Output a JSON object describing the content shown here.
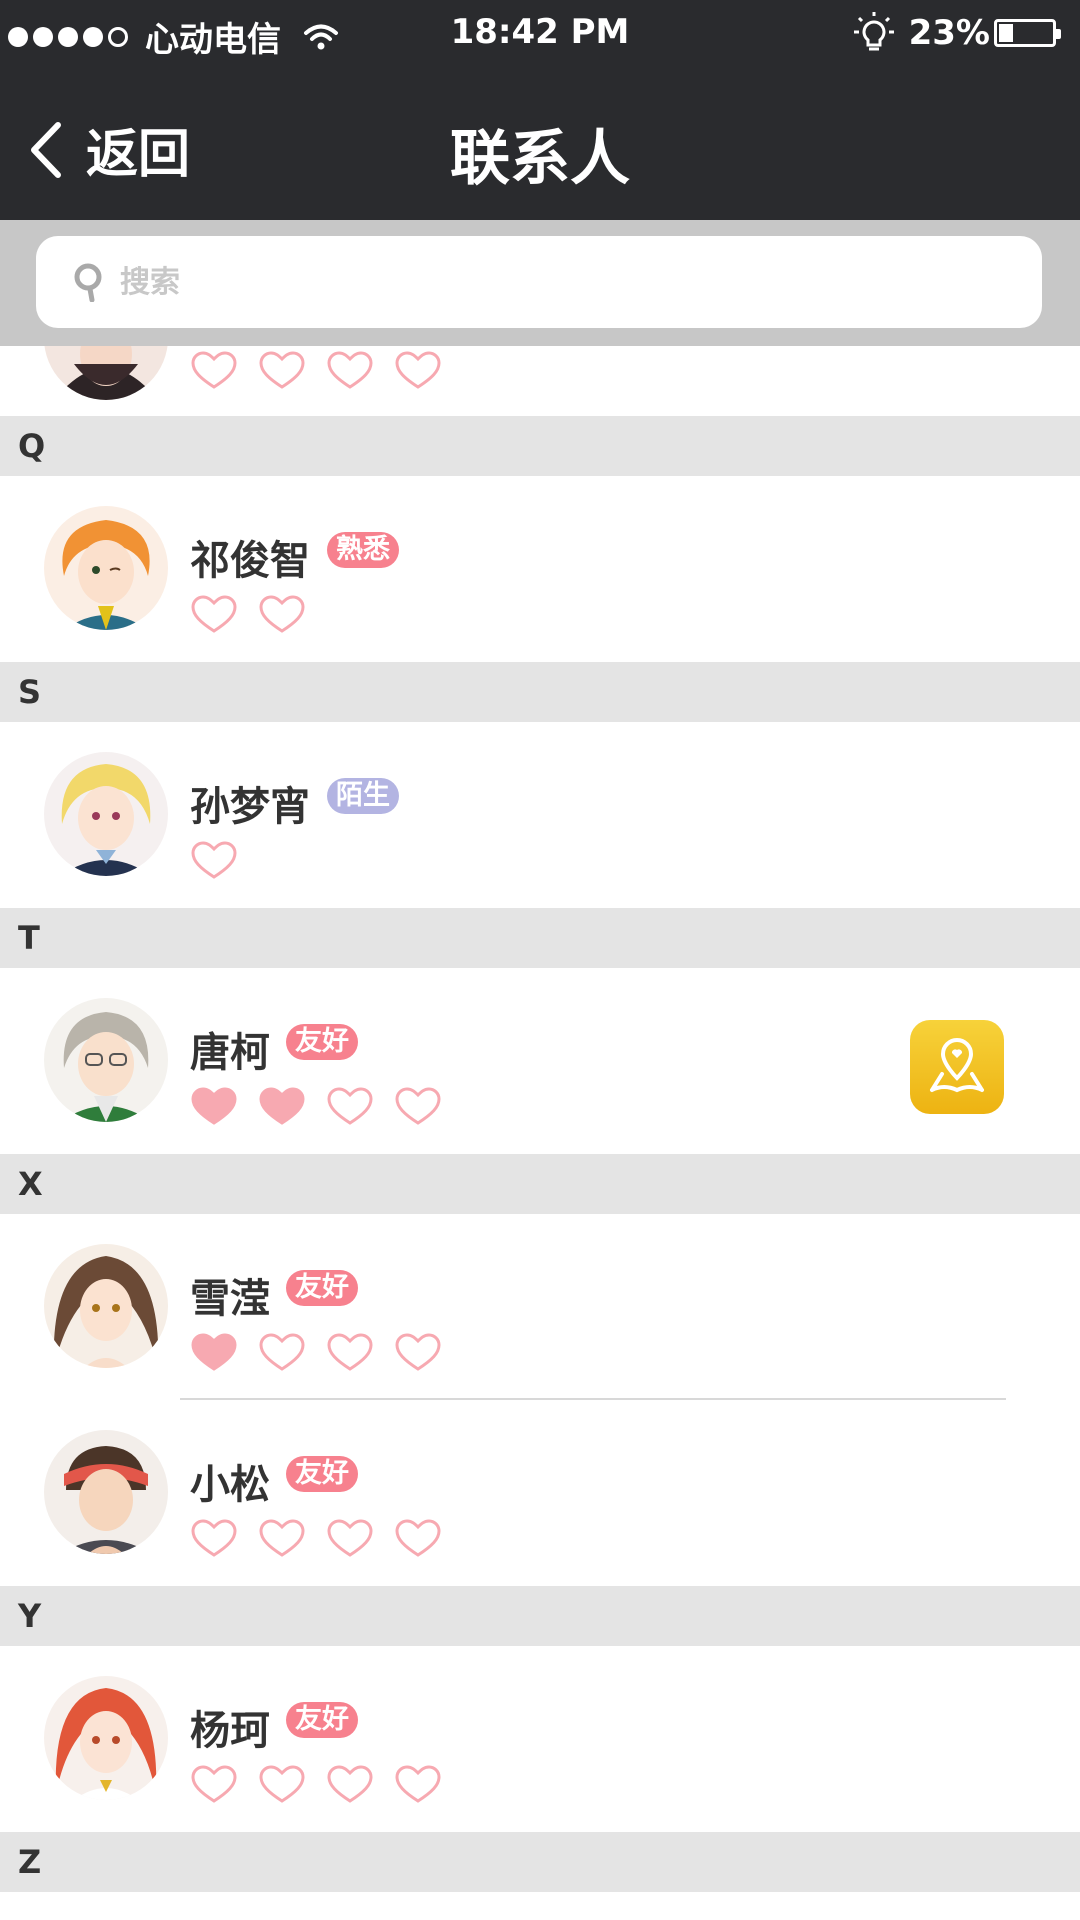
{
  "status_bar": {
    "carrier": "心动电信",
    "time": "18:42 PM",
    "battery": "23%",
    "battery_level": 0.23
  },
  "nav": {
    "back_label": "返回",
    "title": "联系人"
  },
  "search": {
    "placeholder": "搜索"
  },
  "sections": [
    {
      "letter": "Q"
    },
    {
      "letter": "S"
    },
    {
      "letter": "T"
    },
    {
      "letter": "X"
    },
    {
      "letter": "Y"
    },
    {
      "letter": "Z"
    }
  ],
  "contacts": [
    {
      "name": "",
      "tag": "",
      "hearts_filled": 0,
      "hearts_total": 4
    },
    {
      "name": "祁俊智",
      "tag": "熟悉",
      "tag_color": "#f7818e",
      "hearts_filled": 0,
      "hearts_total": 2
    },
    {
      "name": "孙梦宵",
      "tag": "陌生",
      "tag_color": "#b3b4e2",
      "hearts_filled": 0,
      "hearts_total": 1
    },
    {
      "name": "唐柯",
      "tag": "友好",
      "tag_color": "#f7818e",
      "hearts_filled": 2,
      "hearts_total": 4,
      "map_icon": "map-pin-icon"
    },
    {
      "name": "雪滢",
      "tag": "友好",
      "tag_color": "#f7818e",
      "hearts_filled": 1,
      "hearts_total": 4
    },
    {
      "name": "小松",
      "tag": "友好",
      "tag_color": "#f7818e",
      "hearts_filled": 0,
      "hearts_total": 4
    },
    {
      "name": "杨珂",
      "tag": "友好",
      "tag_color": "#f7818e",
      "hearts_filled": 0,
      "hearts_total": 4
    }
  ],
  "colors": {
    "nav_bg": "#2a2b2e",
    "heart": "#f7a9b1",
    "tag_pink": "#f7818e",
    "tag_purple": "#b3b4e2",
    "map_button": "#f2c426"
  }
}
